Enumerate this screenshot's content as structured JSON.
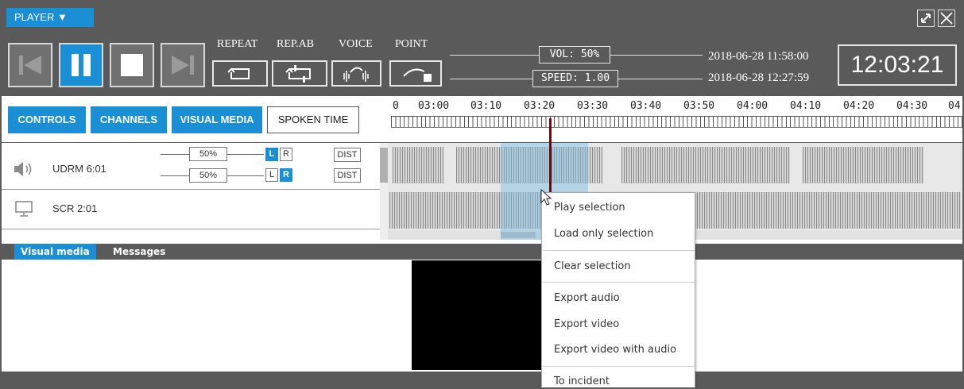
{
  "window": {
    "player_menu_label": "PLAYER ▼",
    "restore_icon": "restore-icon",
    "close_icon": "close-icon"
  },
  "transport": {
    "buttons": [
      "skip-back-icon",
      "pause-icon",
      "stop-icon",
      "skip-forward-icon"
    ],
    "modes": [
      {
        "label": "REPEAT",
        "icon": "repeat-icon"
      },
      {
        "label": "REP.AB",
        "icon": "repeat-ab-icon"
      },
      {
        "label": "VOICE",
        "icon": "voice-icon"
      },
      {
        "label": "POINT",
        "icon": "point-icon"
      }
    ],
    "volume": "VOL: 50%",
    "speed": "SPEED: 1.00",
    "start_datetime": "2018-06-28 11:58:00",
    "end_datetime": "2018-06-28 12:27:59",
    "clock": "12:03:21"
  },
  "tabs": [
    "CONTROLS",
    "CHANNELS",
    "VISUAL MEDIA",
    "SPOKEN TIME"
  ],
  "timeline": {
    "labels": [
      "0",
      "03:00",
      "03:10",
      "03:20",
      "03:30",
      "03:40",
      "03:50",
      "04:00",
      "04:10",
      "04:20",
      "04:30",
      "04"
    ]
  },
  "channels": [
    {
      "name": "UDRM 6:01",
      "icon": "speaker-icon",
      "left_volume": "50%",
      "right_volume": "50%",
      "l_label": "L",
      "r_label": "R",
      "dist_label": "DIST"
    },
    {
      "name": "SCR 2:01",
      "icon": "monitor-icon"
    }
  ],
  "media_tabs": [
    "Visual media",
    "Messages"
  ],
  "context_menu": {
    "items": [
      "Play selection",
      "Load only selection",
      "Clear selection",
      "Export audio",
      "Export video",
      "Export video with audio",
      "To incident"
    ]
  },
  "colors": {
    "accent": "#1a8fd6",
    "chrome": "#5a5a5a",
    "playhead": "#6b0b12",
    "selection": "#a9d6ee"
  }
}
